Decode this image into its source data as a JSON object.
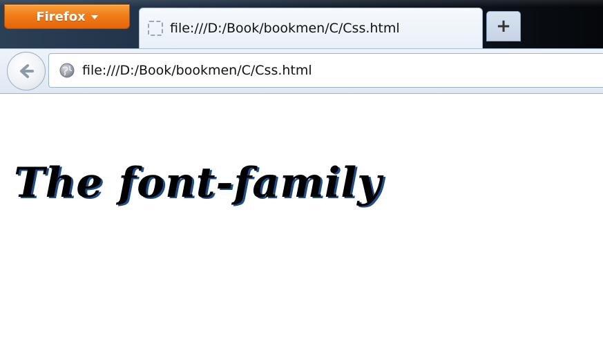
{
  "browser": {
    "app_menu_label": "Firefox",
    "tab": {
      "title": "file:///D:/Book/bookmen/C/Css.html",
      "favicon": "blank-page-icon"
    },
    "new_tab_label": "+",
    "address_bar": {
      "url": "file:///D:/Book/bookmen/C/Css.html",
      "site_icon": "globe-icon"
    },
    "back_icon": "back-arrow-icon"
  },
  "page": {
    "heading": "The font-family"
  },
  "colors": {
    "firefox_button": "#f07d18",
    "heading_text": "#000000",
    "heading_shadow": "#1e4f8c",
    "titlebar": "#1d2e42"
  }
}
